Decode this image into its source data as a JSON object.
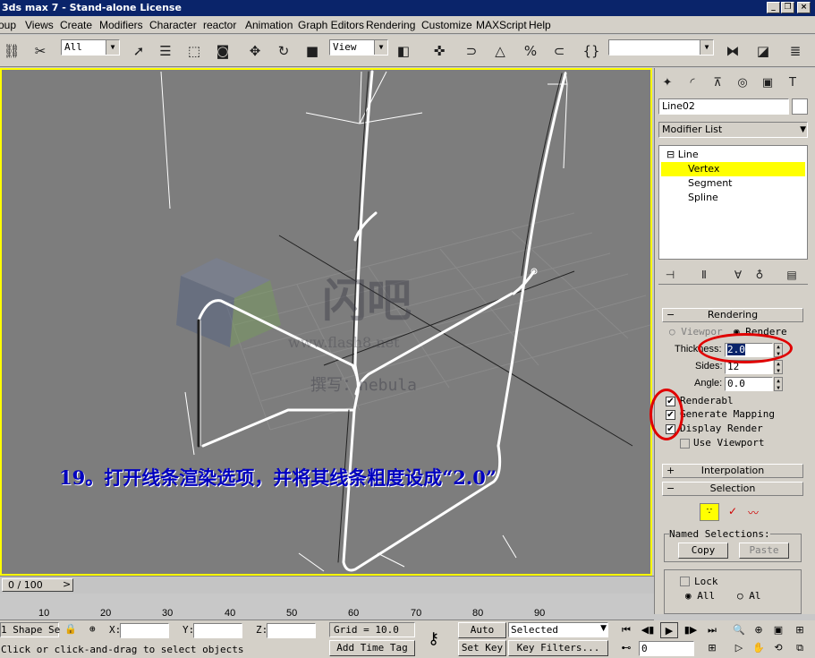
{
  "window": {
    "title": "3ds max 7 - Stand-alone License",
    "controls": [
      "_",
      "❐",
      "×"
    ]
  },
  "menu": [
    "oup",
    "Views",
    "Create",
    "Modifiers",
    "Character",
    "reactor",
    "Animation",
    "Graph Editors",
    "Rendering",
    "Customize",
    "MAXScript",
    "Help"
  ],
  "toolbar": {
    "selection_filter": "All",
    "ref_coord": "View",
    "named_selection": ""
  },
  "viewport": {
    "caption": "19。打开线条渲染选项，并将其线条粗度设成“2.0”",
    "watermark_logo": "闪吧",
    "watermark_url": "www.flash8.net",
    "watermark_author": "撰写：nebula",
    "border_color": "#ffff00",
    "background": "#7d7d7d"
  },
  "panel": {
    "object_name": "Line02",
    "object_color": "#ffffff",
    "modifier_list": "Modifier List",
    "stack": {
      "root": "Line",
      "items": [
        "Vertex",
        "Segment",
        "Spline"
      ],
      "selected": "Vertex"
    },
    "rendering": {
      "title": "Rendering",
      "radio_viewport": "Viewpor",
      "radio_renderer": "Rendere",
      "thickness_label": "Thickness:",
      "thickness": "2.0",
      "sides_label": "Sides:",
      "sides": "12",
      "angle_label": "Angle:",
      "angle": "0.0",
      "renderable": "Renderabl",
      "generate_mapping": "Generate Mapping",
      "display_render": "Display Render",
      "use_viewport": "Use Viewport"
    },
    "interpolation_title": "Interpolation",
    "selection": {
      "title": "Selection",
      "named_label": "Named Selections:",
      "copy": "Copy",
      "paste": "Paste",
      "lock": "Lock",
      "radio_all": "All",
      "radio_al": "Al"
    }
  },
  "timeline": {
    "slider": "0 / 100",
    "ticks": [
      "10",
      "20",
      "30",
      "40",
      "50",
      "60",
      "70",
      "80",
      "90"
    ]
  },
  "status": {
    "selection": "1 Shape Se",
    "x_label": "X:",
    "y_label": "Y:",
    "z_label": "Z:",
    "grid": "Grid = 10.0",
    "auto_key": "Auto Key",
    "set_key": "Set Key",
    "key_mode": "Selected",
    "key_filters": "Key Filters...",
    "frame": "0",
    "prompt": "Click or click-and-drag to select objects",
    "add_time_tag": "Add Time Tag"
  }
}
